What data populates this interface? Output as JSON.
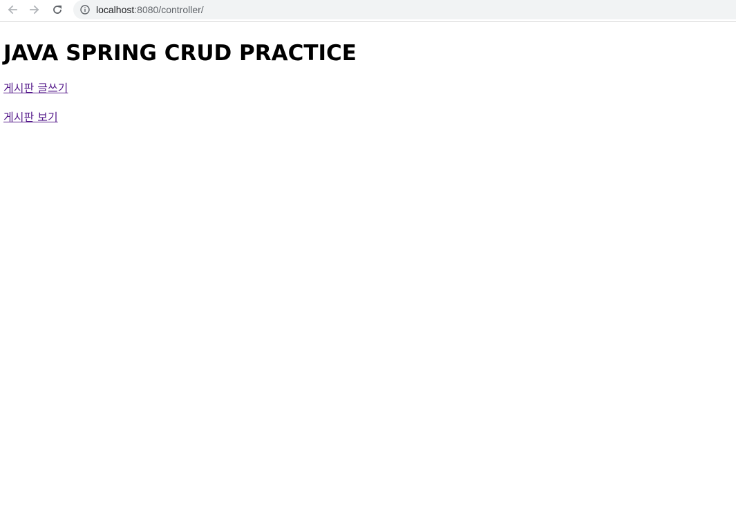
{
  "browser": {
    "back_icon": "arrow-left-icon",
    "forward_icon": "arrow-right-icon",
    "reload_icon": "reload-icon",
    "info_icon": "info-circle-icon",
    "url_host": "localhost",
    "url_rest": ":8080/controller/"
  },
  "page": {
    "title": "JAVA SPRING CRUD PRACTICE",
    "links": [
      {
        "label": "게시판 글쓰기"
      },
      {
        "label": "게시판 보기"
      }
    ],
    "link_color": "#551a8b"
  }
}
